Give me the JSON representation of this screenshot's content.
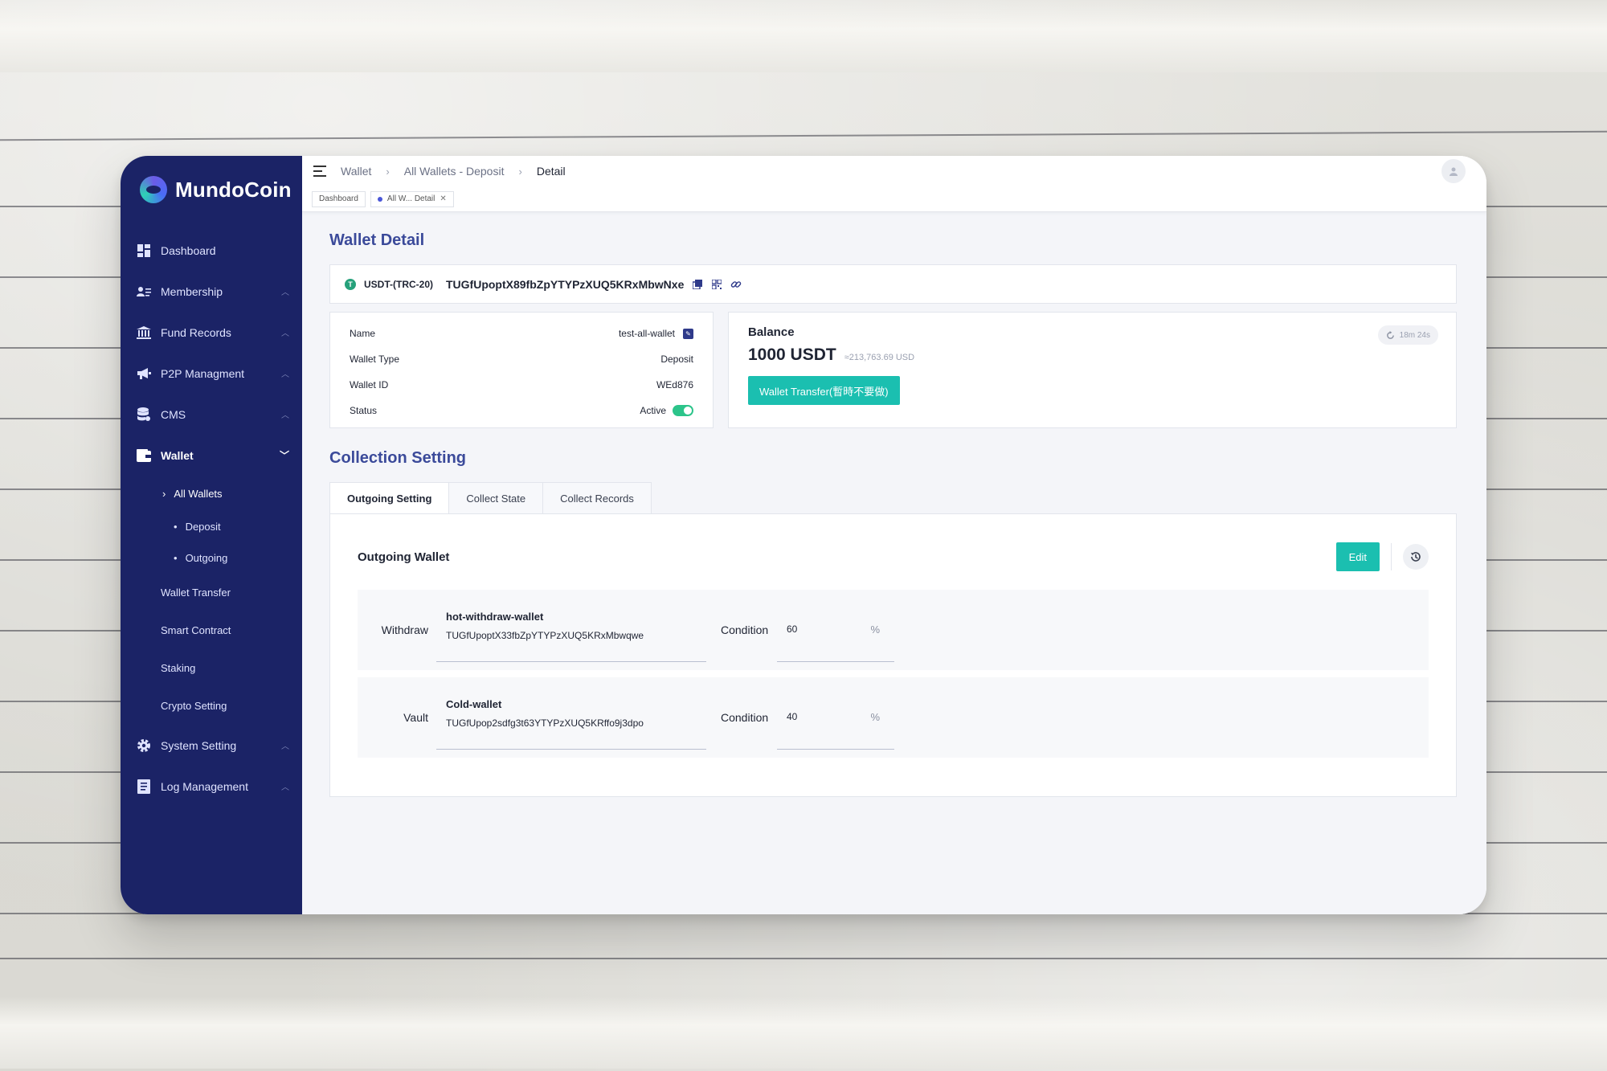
{
  "brand": {
    "name": "MundoCoin"
  },
  "sidebar": {
    "items": [
      {
        "label": "Dashboard",
        "icon": "dashboard-icon"
      },
      {
        "label": "Membership",
        "icon": "membership-icon"
      },
      {
        "label": "Fund Records",
        "icon": "bank-icon"
      },
      {
        "label": "P2P Managment",
        "icon": "megaphone-icon"
      },
      {
        "label": "CMS",
        "icon": "database-icon"
      },
      {
        "label": "Wallet",
        "icon": "wallet-icon"
      },
      {
        "label": "System Setting",
        "icon": "gear-icon"
      },
      {
        "label": "Log Management",
        "icon": "log-icon"
      }
    ],
    "wallet_sub": {
      "all_wallets": "All Wallets",
      "deposit": "Deposit",
      "outgoing": "Outgoing",
      "wallet_transfer": "Wallet Transfer",
      "smart_contract": "Smart Contract",
      "staking": "Staking",
      "crypto_setting": "Crypto Setting"
    }
  },
  "breadcrumb": [
    "Wallet",
    "All Wallets - Deposit",
    "Detail"
  ],
  "view_tabs": {
    "dashboard": "Dashboard",
    "current": "All W... Detail"
  },
  "page": {
    "title": "Wallet Detail",
    "token": "USDT-(TRC-20)",
    "address": "TUGfUpoptX89fbZpYTYPzXUQ5KRxMbwNxe"
  },
  "info": {
    "name_label": "Name",
    "name_value": "test-all-wallet",
    "type_label": "Wallet Type",
    "type_value": "Deposit",
    "id_label": "Wallet ID",
    "id_value": "WEd876",
    "status_label": "Status",
    "status_value": "Active"
  },
  "balance": {
    "title": "Balance",
    "amount": "1000 USDT",
    "usd": "≈213,763.69 USD",
    "refresh": "18m 24s",
    "transfer_button": "Wallet Transfer(暫時不要做)"
  },
  "collection": {
    "title": "Collection Setting",
    "tabs": [
      "Outgoing Setting",
      "Collect State",
      "Collect Records"
    ],
    "panel_title": "Outgoing Wallet",
    "edit_button": "Edit",
    "rows": [
      {
        "label": "Withdraw",
        "wallet_name": "hot-withdraw-wallet",
        "wallet_address": "TUGfUpoptX33fbZpYTYPzXUQ5KRxMbwqwe",
        "condition_label": "Condition",
        "condition_value": "60",
        "unit": "%"
      },
      {
        "label": "Vault",
        "wallet_name": "Cold-wallet",
        "wallet_address": "TUGfUpop2sdfg3t63YTYPzXUQ5KRffo9j3dpo",
        "condition_label": "Condition",
        "condition_value": "40",
        "unit": "%"
      }
    ]
  },
  "colors": {
    "sidebar": "#1b2366",
    "accent": "#1bbfb0",
    "title": "#3b4a9a"
  }
}
